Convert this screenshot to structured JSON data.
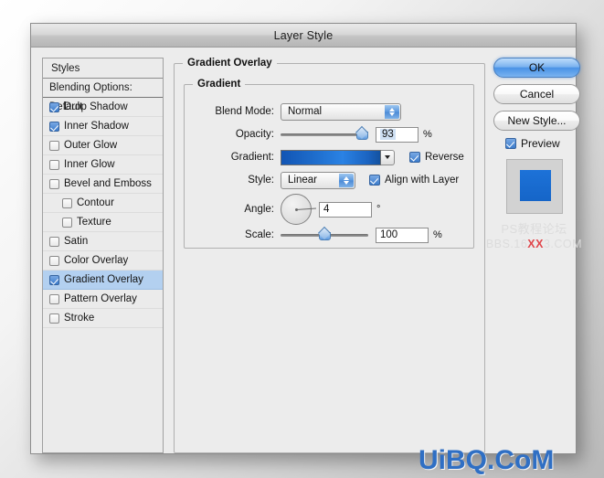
{
  "window": {
    "title": "Layer Style"
  },
  "styles_panel": {
    "header": "Styles",
    "blending_options": "Blending Options: Default",
    "items": [
      {
        "label": "Drop Shadow",
        "checked": true,
        "indent": false,
        "selected": false
      },
      {
        "label": "Inner Shadow",
        "checked": true,
        "indent": false,
        "selected": false
      },
      {
        "label": "Outer Glow",
        "checked": false,
        "indent": false,
        "selected": false
      },
      {
        "label": "Inner Glow",
        "checked": false,
        "indent": false,
        "selected": false
      },
      {
        "label": "Bevel and Emboss",
        "checked": false,
        "indent": false,
        "selected": false
      },
      {
        "label": "Contour",
        "checked": false,
        "indent": true,
        "selected": false
      },
      {
        "label": "Texture",
        "checked": false,
        "indent": true,
        "selected": false
      },
      {
        "label": "Satin",
        "checked": false,
        "indent": false,
        "selected": false
      },
      {
        "label": "Color Overlay",
        "checked": false,
        "indent": false,
        "selected": false
      },
      {
        "label": "Gradient Overlay",
        "checked": true,
        "indent": false,
        "selected": true
      },
      {
        "label": "Pattern Overlay",
        "checked": false,
        "indent": false,
        "selected": false
      },
      {
        "label": "Stroke",
        "checked": false,
        "indent": false,
        "selected": false
      }
    ]
  },
  "main": {
    "group_title": "Gradient Overlay",
    "subgroup_title": "Gradient",
    "blend_mode": {
      "label": "Blend Mode:",
      "value": "Normal"
    },
    "opacity": {
      "label": "Opacity:",
      "value": "93",
      "unit": "%",
      "percent": 93
    },
    "gradient": {
      "label": "Gradient:",
      "start_color": "#1255b4",
      "end_color": "#14529f"
    },
    "reverse": {
      "label": "Reverse",
      "checked": true
    },
    "style": {
      "label": "Style:",
      "value": "Linear"
    },
    "align_with_layer": {
      "label": "Align with Layer",
      "checked": true
    },
    "angle": {
      "label": "Angle:",
      "value": "4",
      "unit": "°",
      "degrees": 4
    },
    "scale": {
      "label": "Scale:",
      "value": "100",
      "unit": "%",
      "percent": 50
    }
  },
  "buttons": {
    "ok": "OK",
    "cancel": "Cancel",
    "new_style": "New Style...",
    "preview": {
      "label": "Preview",
      "checked": true
    }
  },
  "watermarks": {
    "ps_line1": "PS教程论坛",
    "ps_line2_a": "BBS.16",
    "ps_line2_xx": "XX",
    "ps_line2_b": "3.COM",
    "uibq": "UiBQ.CoM"
  }
}
